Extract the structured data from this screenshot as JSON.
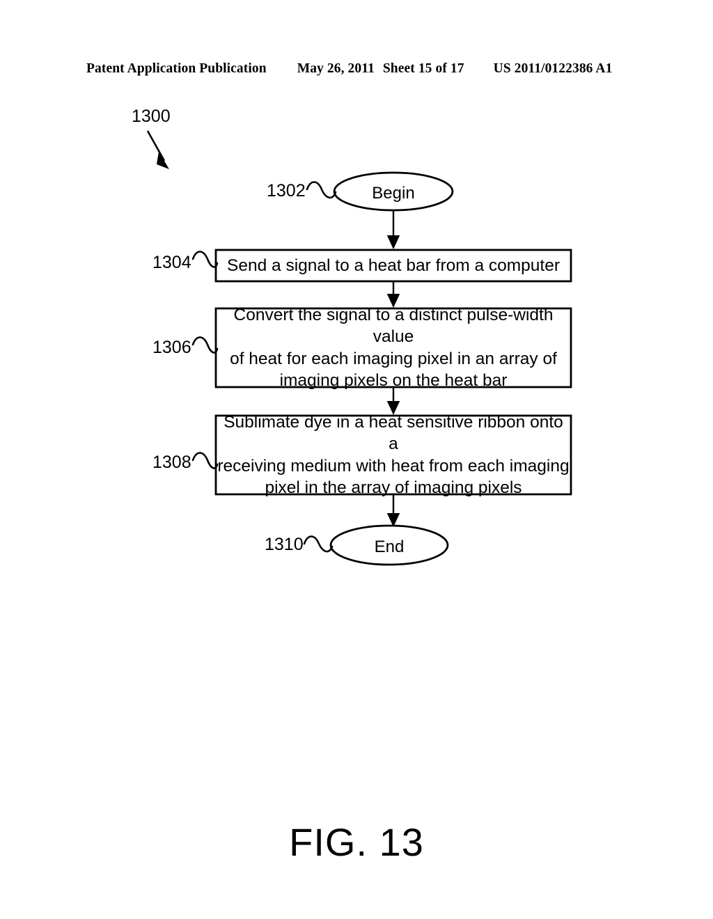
{
  "header": {
    "publication": "Patent Application Publication",
    "date": "May 26, 2011",
    "sheet": "Sheet 15 of 17",
    "doc_number": "US 2011/0122386 A1"
  },
  "figure": {
    "caption": "FIG. 13",
    "diagram_ref": "1300",
    "stroke_color": "#000000",
    "fill_color": "#ffffff"
  },
  "flowchart": {
    "type": "flowchart",
    "nodes": [
      {
        "ref": "1302",
        "shape": "ellipse",
        "label": "Begin",
        "lines": [
          "Begin"
        ]
      },
      {
        "ref": "1304",
        "shape": "rectangle",
        "label": "Send a signal to a heat bar from a computer",
        "lines": [
          "Send a signal to a heat bar from a computer"
        ]
      },
      {
        "ref": "1306",
        "shape": "rectangle",
        "label": "Convert the signal to a distinct pulse-width value of heat for each imaging pixel in an array of imaging pixels on the heat bar",
        "lines": [
          "Convert the signal to a distinct pulse-width value",
          "of heat for each imaging pixel in an array of",
          "imaging pixels on the heat bar"
        ]
      },
      {
        "ref": "1308",
        "shape": "rectangle",
        "label": "Sublimate dye in a heat sensitive ribbon onto a receiving medium with heat from each imaging pixel in the array of imaging pixels",
        "lines": [
          "Sublimate dye in a heat sensitive ribbon onto a",
          "receiving medium with heat from each imaging",
          "pixel in the array of imaging pixels"
        ]
      },
      {
        "ref": "1310",
        "shape": "ellipse",
        "label": "End",
        "lines": [
          "End"
        ]
      }
    ],
    "edges": [
      {
        "from": "1302",
        "to": "1304",
        "style": "arrow-down"
      },
      {
        "from": "1304",
        "to": "1306",
        "style": "arrow-down"
      },
      {
        "from": "1306",
        "to": "1308",
        "style": "arrow-down"
      },
      {
        "from": "1308",
        "to": "1310",
        "style": "arrow-down"
      }
    ]
  }
}
